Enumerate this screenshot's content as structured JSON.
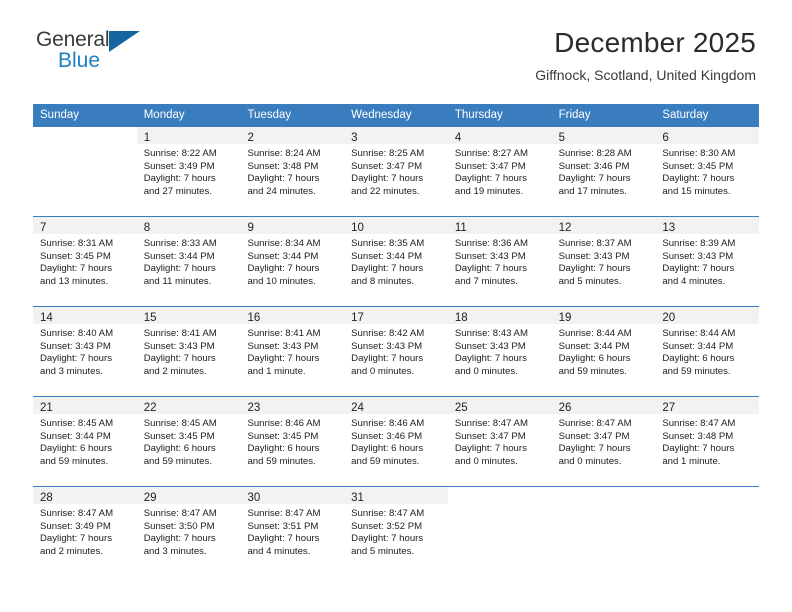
{
  "logo": {
    "primary_text": "General",
    "secondary_text": "Blue",
    "primary_color": "#3b3b3b",
    "secondary_color": "#1f7ec2",
    "triangle_color": "#15659e"
  },
  "header": {
    "title": "December 2025",
    "subtitle": "Giffnock, Scotland, United Kingdom",
    "header_bg_color": "#3a7dbf",
    "header_text_color": "#ffffff"
  },
  "calendar": {
    "weekday_headers": [
      "Sunday",
      "Monday",
      "Tuesday",
      "Wednesday",
      "Thursday",
      "Friday",
      "Saturday"
    ],
    "weeks": [
      [
        {
          "day": "",
          "sunrise": "",
          "sunset": "",
          "daylight_line1": "",
          "daylight_line2": ""
        },
        {
          "day": "1",
          "sunrise": "Sunrise: 8:22 AM",
          "sunset": "Sunset: 3:49 PM",
          "daylight_line1": "Daylight: 7 hours",
          "daylight_line2": "and 27 minutes."
        },
        {
          "day": "2",
          "sunrise": "Sunrise: 8:24 AM",
          "sunset": "Sunset: 3:48 PM",
          "daylight_line1": "Daylight: 7 hours",
          "daylight_line2": "and 24 minutes."
        },
        {
          "day": "3",
          "sunrise": "Sunrise: 8:25 AM",
          "sunset": "Sunset: 3:47 PM",
          "daylight_line1": "Daylight: 7 hours",
          "daylight_line2": "and 22 minutes."
        },
        {
          "day": "4",
          "sunrise": "Sunrise: 8:27 AM",
          "sunset": "Sunset: 3:47 PM",
          "daylight_line1": "Daylight: 7 hours",
          "daylight_line2": "and 19 minutes."
        },
        {
          "day": "5",
          "sunrise": "Sunrise: 8:28 AM",
          "sunset": "Sunset: 3:46 PM",
          "daylight_line1": "Daylight: 7 hours",
          "daylight_line2": "and 17 minutes."
        },
        {
          "day": "6",
          "sunrise": "Sunrise: 8:30 AM",
          "sunset": "Sunset: 3:45 PM",
          "daylight_line1": "Daylight: 7 hours",
          "daylight_line2": "and 15 minutes."
        }
      ],
      [
        {
          "day": "7",
          "sunrise": "Sunrise: 8:31 AM",
          "sunset": "Sunset: 3:45 PM",
          "daylight_line1": "Daylight: 7 hours",
          "daylight_line2": "and 13 minutes."
        },
        {
          "day": "8",
          "sunrise": "Sunrise: 8:33 AM",
          "sunset": "Sunset: 3:44 PM",
          "daylight_line1": "Daylight: 7 hours",
          "daylight_line2": "and 11 minutes."
        },
        {
          "day": "9",
          "sunrise": "Sunrise: 8:34 AM",
          "sunset": "Sunset: 3:44 PM",
          "daylight_line1": "Daylight: 7 hours",
          "daylight_line2": "and 10 minutes."
        },
        {
          "day": "10",
          "sunrise": "Sunrise: 8:35 AM",
          "sunset": "Sunset: 3:44 PM",
          "daylight_line1": "Daylight: 7 hours",
          "daylight_line2": "and 8 minutes."
        },
        {
          "day": "11",
          "sunrise": "Sunrise: 8:36 AM",
          "sunset": "Sunset: 3:43 PM",
          "daylight_line1": "Daylight: 7 hours",
          "daylight_line2": "and 7 minutes."
        },
        {
          "day": "12",
          "sunrise": "Sunrise: 8:37 AM",
          "sunset": "Sunset: 3:43 PM",
          "daylight_line1": "Daylight: 7 hours",
          "daylight_line2": "and 5 minutes."
        },
        {
          "day": "13",
          "sunrise": "Sunrise: 8:39 AM",
          "sunset": "Sunset: 3:43 PM",
          "daylight_line1": "Daylight: 7 hours",
          "daylight_line2": "and 4 minutes."
        }
      ],
      [
        {
          "day": "14",
          "sunrise": "Sunrise: 8:40 AM",
          "sunset": "Sunset: 3:43 PM",
          "daylight_line1": "Daylight: 7 hours",
          "daylight_line2": "and 3 minutes."
        },
        {
          "day": "15",
          "sunrise": "Sunrise: 8:41 AM",
          "sunset": "Sunset: 3:43 PM",
          "daylight_line1": "Daylight: 7 hours",
          "daylight_line2": "and 2 minutes."
        },
        {
          "day": "16",
          "sunrise": "Sunrise: 8:41 AM",
          "sunset": "Sunset: 3:43 PM",
          "daylight_line1": "Daylight: 7 hours",
          "daylight_line2": "and 1 minute."
        },
        {
          "day": "17",
          "sunrise": "Sunrise: 8:42 AM",
          "sunset": "Sunset: 3:43 PM",
          "daylight_line1": "Daylight: 7 hours",
          "daylight_line2": "and 0 minutes."
        },
        {
          "day": "18",
          "sunrise": "Sunrise: 8:43 AM",
          "sunset": "Sunset: 3:43 PM",
          "daylight_line1": "Daylight: 7 hours",
          "daylight_line2": "and 0 minutes."
        },
        {
          "day": "19",
          "sunrise": "Sunrise: 8:44 AM",
          "sunset": "Sunset: 3:44 PM",
          "daylight_line1": "Daylight: 6 hours",
          "daylight_line2": "and 59 minutes."
        },
        {
          "day": "20",
          "sunrise": "Sunrise: 8:44 AM",
          "sunset": "Sunset: 3:44 PM",
          "daylight_line1": "Daylight: 6 hours",
          "daylight_line2": "and 59 minutes."
        }
      ],
      [
        {
          "day": "21",
          "sunrise": "Sunrise: 8:45 AM",
          "sunset": "Sunset: 3:44 PM",
          "daylight_line1": "Daylight: 6 hours",
          "daylight_line2": "and 59 minutes."
        },
        {
          "day": "22",
          "sunrise": "Sunrise: 8:45 AM",
          "sunset": "Sunset: 3:45 PM",
          "daylight_line1": "Daylight: 6 hours",
          "daylight_line2": "and 59 minutes."
        },
        {
          "day": "23",
          "sunrise": "Sunrise: 8:46 AM",
          "sunset": "Sunset: 3:45 PM",
          "daylight_line1": "Daylight: 6 hours",
          "daylight_line2": "and 59 minutes."
        },
        {
          "day": "24",
          "sunrise": "Sunrise: 8:46 AM",
          "sunset": "Sunset: 3:46 PM",
          "daylight_line1": "Daylight: 6 hours",
          "daylight_line2": "and 59 minutes."
        },
        {
          "day": "25",
          "sunrise": "Sunrise: 8:47 AM",
          "sunset": "Sunset: 3:47 PM",
          "daylight_line1": "Daylight: 7 hours",
          "daylight_line2": "and 0 minutes."
        },
        {
          "day": "26",
          "sunrise": "Sunrise: 8:47 AM",
          "sunset": "Sunset: 3:47 PM",
          "daylight_line1": "Daylight: 7 hours",
          "daylight_line2": "and 0 minutes."
        },
        {
          "day": "27",
          "sunrise": "Sunrise: 8:47 AM",
          "sunset": "Sunset: 3:48 PM",
          "daylight_line1": "Daylight: 7 hours",
          "daylight_line2": "and 1 minute."
        }
      ],
      [
        {
          "day": "28",
          "sunrise": "Sunrise: 8:47 AM",
          "sunset": "Sunset: 3:49 PM",
          "daylight_line1": "Daylight: 7 hours",
          "daylight_line2": "and 2 minutes."
        },
        {
          "day": "29",
          "sunrise": "Sunrise: 8:47 AM",
          "sunset": "Sunset: 3:50 PM",
          "daylight_line1": "Daylight: 7 hours",
          "daylight_line2": "and 3 minutes."
        },
        {
          "day": "30",
          "sunrise": "Sunrise: 8:47 AM",
          "sunset": "Sunset: 3:51 PM",
          "daylight_line1": "Daylight: 7 hours",
          "daylight_line2": "and 4 minutes."
        },
        {
          "day": "31",
          "sunrise": "Sunrise: 8:47 AM",
          "sunset": "Sunset: 3:52 PM",
          "daylight_line1": "Daylight: 7 hours",
          "daylight_line2": "and 5 minutes."
        },
        {
          "day": "",
          "sunrise": "",
          "sunset": "",
          "daylight_line1": "",
          "daylight_line2": ""
        },
        {
          "day": "",
          "sunrise": "",
          "sunset": "",
          "daylight_line1": "",
          "daylight_line2": ""
        },
        {
          "day": "",
          "sunrise": "",
          "sunset": "",
          "daylight_line1": "",
          "daylight_line2": ""
        }
      ]
    ]
  }
}
